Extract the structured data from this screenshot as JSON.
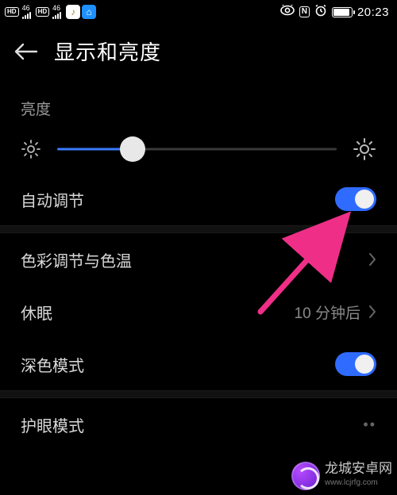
{
  "statusbar": {
    "hd": "HD",
    "net1": "46",
    "net2": "46",
    "time": "20:23",
    "nfc": "N"
  },
  "header": {
    "title": "显示和亮度"
  },
  "brightness": {
    "label": "亮度",
    "auto_label": "自动调节",
    "auto_on": true,
    "value_pct": 27
  },
  "rows": {
    "color_temp": {
      "label": "色彩调节与色温"
    },
    "sleep": {
      "label": "休眠",
      "value": "10 分钟后"
    },
    "dark_mode": {
      "label": "深色模式",
      "on": true
    },
    "eye_comfort": {
      "label": "护眼模式"
    }
  },
  "watermark": {
    "name": "龙城安卓网",
    "url": "www.lcjrfg.com"
  },
  "colors": {
    "accent": "#2f6bff",
    "annotation": "#ef2f87"
  }
}
